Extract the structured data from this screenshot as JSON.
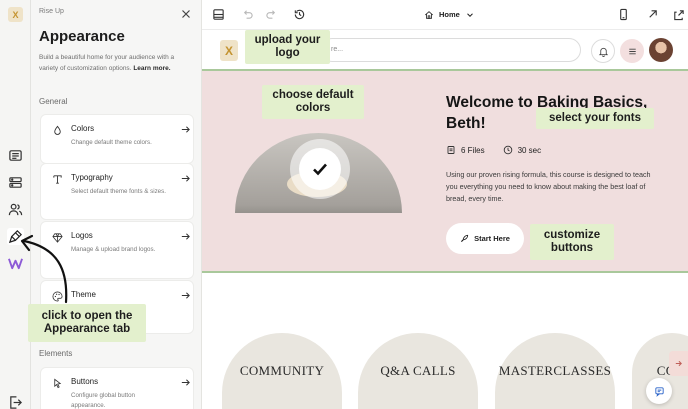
{
  "rail": {
    "logo_text": "X",
    "icons": [
      "pages-icon",
      "collections-icon",
      "members-icon",
      "appearance-brush-icon",
      "w-brand-icon",
      "exit-icon"
    ]
  },
  "panel": {
    "brand": "Rise Up",
    "title": "Appearance",
    "description": "Build a beautiful home for your audience with a variety of customization options.",
    "learn_more": "Learn more.",
    "general_label": "General",
    "elements_label": "Elements",
    "cards": [
      {
        "title": "Colors",
        "desc": "Change default theme colors.",
        "icon": "droplet-icon"
      },
      {
        "title": "Typography",
        "desc": "Select default theme fonts & sizes.",
        "icon": "typography-icon"
      },
      {
        "title": "Logos",
        "desc": "Manage & upload brand logos.",
        "icon": "gem-icon"
      },
      {
        "title": "Theme",
        "desc": "",
        "icon": "palette-icon"
      },
      {
        "title": "Buttons",
        "desc": "Configure global button appearance.",
        "icon": "pointer-icon"
      }
    ]
  },
  "toolbar": {
    "page_name": "Home"
  },
  "site_header": {
    "search_placeholder": "re...",
    "logo_text": "X"
  },
  "hero": {
    "title": "Welcome to Baking Basics, Beth!",
    "files": "6 Files",
    "duration": "30 sec",
    "description": "Using our proven rising formula, this course is designed to teach you everything you need to know about making the best loaf of bread, every time.",
    "cta_label": "Start Here"
  },
  "collections": [
    "COMMUNITY",
    "Q&A CALLS",
    "MASTERCLASSES",
    "COM"
  ],
  "callouts": {
    "upload_logo": "upload your logo",
    "default_colors": "choose default colors",
    "select_fonts": "select your fonts",
    "customize_buttons": "customize buttons",
    "open_tab": "click to open the Appearance tab"
  },
  "colors": {
    "hero_bg": "#f0dede",
    "callout_bg": "#e3f0cd",
    "accent_green": "#a9c89b",
    "panel_bg": "#f6f6f5"
  }
}
